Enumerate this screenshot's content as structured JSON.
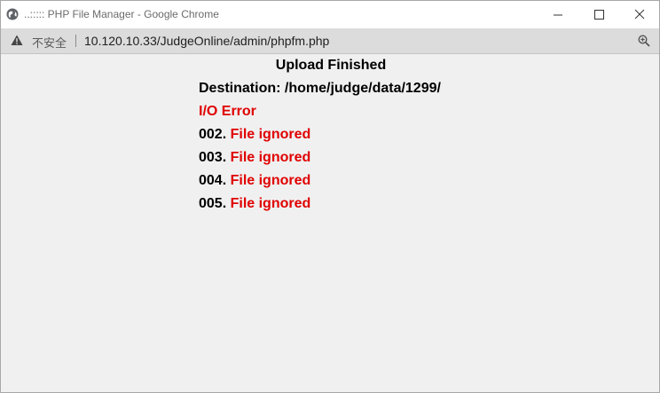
{
  "window": {
    "title": "..::::: PHP File Manager - Google Chrome"
  },
  "addressbar": {
    "security_label": "不安全",
    "url": "10.120.10.33/JudgeOnline/admin/phpfm.php"
  },
  "page": {
    "heading": "Upload Finished",
    "destination": "Destination: /home/judge/data/1299/",
    "error": "I/O Error",
    "files": [
      {
        "number": "002.",
        "status": "File ignored"
      },
      {
        "number": "003.",
        "status": "File ignored"
      },
      {
        "number": "004.",
        "status": "File ignored"
      },
      {
        "number": "005.",
        "status": "File ignored"
      }
    ]
  },
  "colors": {
    "error_red": "#e00000",
    "window_background": "#f0f0f0",
    "addressbar_background": "#dcdcdc"
  },
  "icons": {
    "title": "globe-icon",
    "security": "warning-icon",
    "zoom": "zoom-icon",
    "minimize": "minimize-icon",
    "maximize": "maximize-icon",
    "close": "close-icon"
  }
}
